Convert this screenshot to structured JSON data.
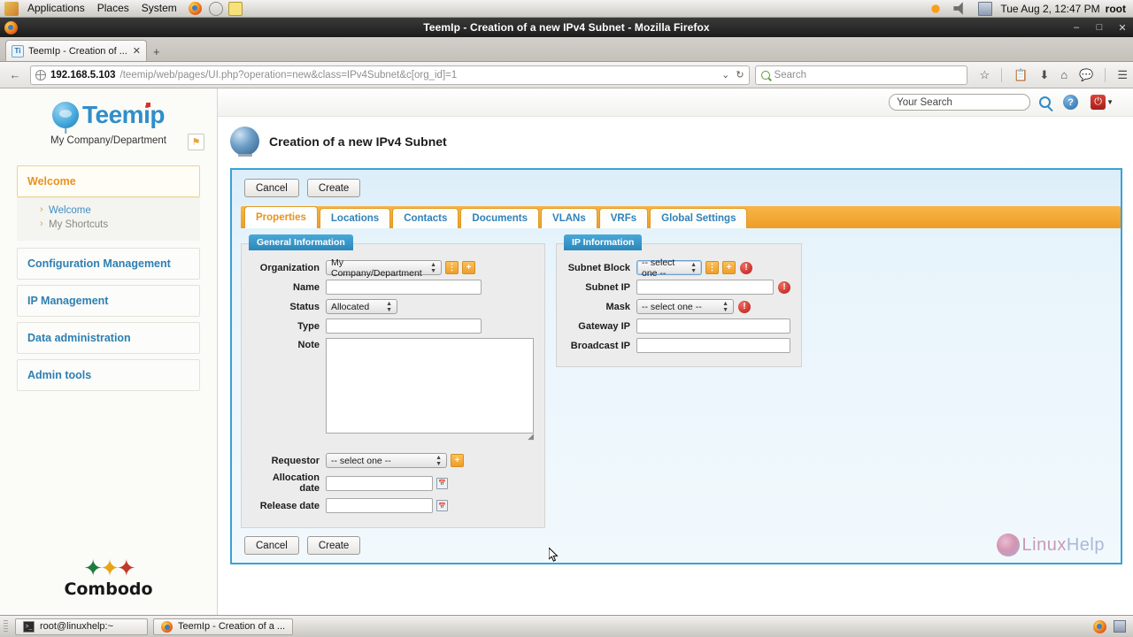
{
  "desktop": {
    "menus": [
      "Applications",
      "Places",
      "System"
    ],
    "launchers": [
      "firefox-launcher-icon",
      "help-launcher-icon",
      "text-editor-launcher-icon"
    ],
    "tray_icons": [
      "brightness-icon",
      "volume-icon",
      "display-icon"
    ],
    "clock": "Tue Aug  2, 12:47 PM",
    "user": "root"
  },
  "browser": {
    "window_title": "TeemIp - Creation of a new IPv4 Subnet - Mozilla Firefox",
    "window_buttons": {
      "minimize": "–",
      "maximize": "□",
      "close": "✕"
    },
    "tab": {
      "favicon_text": "Ti",
      "label": "TeemIp - Creation of ...",
      "close": "✕"
    },
    "new_tab_label": "+",
    "url": {
      "host": "192.168.5.103",
      "path": "/teemip/web/pages/UI.php?operation=new&class=IPv4Subnet&c[org_id]=1"
    },
    "url_dropdown": "⌄",
    "reload_icon": "↻",
    "search": {
      "placeholder": "Search"
    },
    "toolbar_icons": [
      "bookmark-star-icon",
      "reading-list-icon",
      "downloads-icon",
      "home-icon",
      "chat-icon",
      "menu-hamburger-icon"
    ],
    "back_icon": "←"
  },
  "sidebar": {
    "brand": "Teemip",
    "org": "My Company/Department",
    "pin_icon": "⚑",
    "groups": [
      {
        "label": "Welcome",
        "active": true,
        "items": [
          {
            "label": "Welcome",
            "muted": false
          },
          {
            "label": "My Shortcuts",
            "muted": true
          }
        ]
      },
      {
        "label": "Configuration Management",
        "active": false,
        "items": []
      },
      {
        "label": "IP Management",
        "active": false,
        "items": []
      },
      {
        "label": "Data administration",
        "active": false,
        "items": []
      },
      {
        "label": "Admin tools",
        "active": false,
        "items": []
      }
    ],
    "footer_logo": "Combodo"
  },
  "topbar": {
    "search_value": "Your Search",
    "search_icon": "magnifier-icon",
    "help_icon": "?",
    "power_icon": "⏻",
    "power_caret": "▼"
  },
  "page": {
    "title": "Creation of a new IPv4 Subnet",
    "icon": "globe-subnet-icon"
  },
  "actions": {
    "cancel": "Cancel",
    "create": "Create"
  },
  "tabs": [
    {
      "label": "Properties",
      "selected": true
    },
    {
      "label": "Locations",
      "selected": false
    },
    {
      "label": "Contacts",
      "selected": false
    },
    {
      "label": "Documents",
      "selected": false
    },
    {
      "label": "VLANs",
      "selected": false
    },
    {
      "label": "VRFs",
      "selected": false
    },
    {
      "label": "Global Settings",
      "selected": false
    }
  ],
  "general_information": {
    "title": "General Information",
    "fields": {
      "organization": {
        "label": "Organization",
        "value": "My Company/Department",
        "buttons": [
          "hierarchy-picker-icon",
          "+"
        ]
      },
      "name": {
        "label": "Name",
        "value": ""
      },
      "status": {
        "label": "Status",
        "value": "Allocated"
      },
      "type": {
        "label": "Type",
        "value": ""
      },
      "note": {
        "label": "Note",
        "value": ""
      },
      "requestor": {
        "label": "Requestor",
        "value": "-- select one --",
        "buttons": [
          "+"
        ]
      },
      "allocation_date": {
        "label": "Allocation date",
        "value": "",
        "picker": "calendar-icon"
      },
      "release_date": {
        "label": "Release date",
        "value": "",
        "picker": "calendar-icon"
      }
    }
  },
  "ip_information": {
    "title": "IP Information",
    "fields": {
      "subnet_block": {
        "label": "Subnet Block",
        "value": "-- select one --",
        "buttons": [
          "hierarchy-picker-icon",
          "+"
        ],
        "error": "!"
      },
      "subnet_ip": {
        "label": "Subnet IP",
        "value": "",
        "error": "!"
      },
      "mask": {
        "label": "Mask",
        "value": "-- select one --",
        "error": "!"
      },
      "gateway_ip": {
        "label": "Gateway IP",
        "value": ""
      },
      "broadcast_ip": {
        "label": "Broadcast IP",
        "value": ""
      }
    }
  },
  "watermark": {
    "text_a": "Linux",
    "text_b": "Help"
  },
  "taskbar": {
    "items": [
      {
        "label": "root@linuxhelp:~",
        "icon": "terminal-icon"
      },
      {
        "label": "TeemIp - Creation of a ...",
        "icon": "firefox-icon"
      }
    ]
  },
  "colors": {
    "accent_blue": "#2f89c6",
    "accent_orange": "#ef9d26",
    "error_red": "#b81d14",
    "panel_border": "#3ba1d8"
  }
}
